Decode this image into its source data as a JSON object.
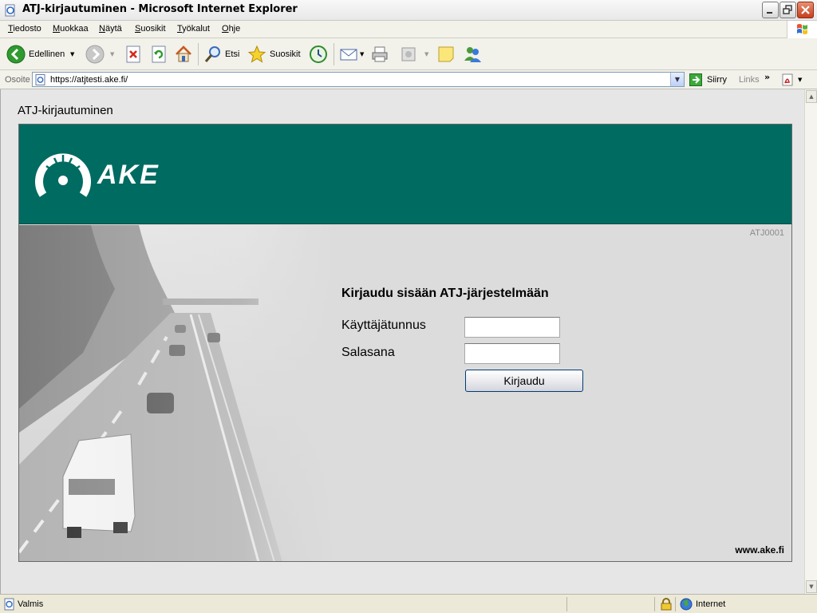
{
  "window": {
    "title": "ATJ-kirjautuminen - Microsoft Internet Explorer"
  },
  "menu": [
    "Tiedosto",
    "Muokkaa",
    "Näytä",
    "Suosikit",
    "Työkalut",
    "Ohje"
  ],
  "toolbar": {
    "back_label": "Edellinen",
    "search_label": "Etsi",
    "favorites_label": "Suosikit"
  },
  "address": {
    "label": "Osoite",
    "url": "https://atjtesti.ake.fi/",
    "go_label": "Siirry",
    "links_label": "Links"
  },
  "page": {
    "heading": "ATJ-kirjautuminen",
    "logo_text": "AKE",
    "code": "ATJ0001",
    "login_title": "Kirjaudu sisään ATJ-järjestelmään",
    "username_label": "Käyttäjätunnus",
    "password_label": "Salasana",
    "username_value": "",
    "password_value": "",
    "submit_label": "Kirjaudu",
    "site_url": "www.ake.fi"
  },
  "status": {
    "text": "Valmis",
    "zone": "Internet"
  },
  "colors": {
    "banner": "#006b61",
    "chrome": "#f2f1ea"
  }
}
